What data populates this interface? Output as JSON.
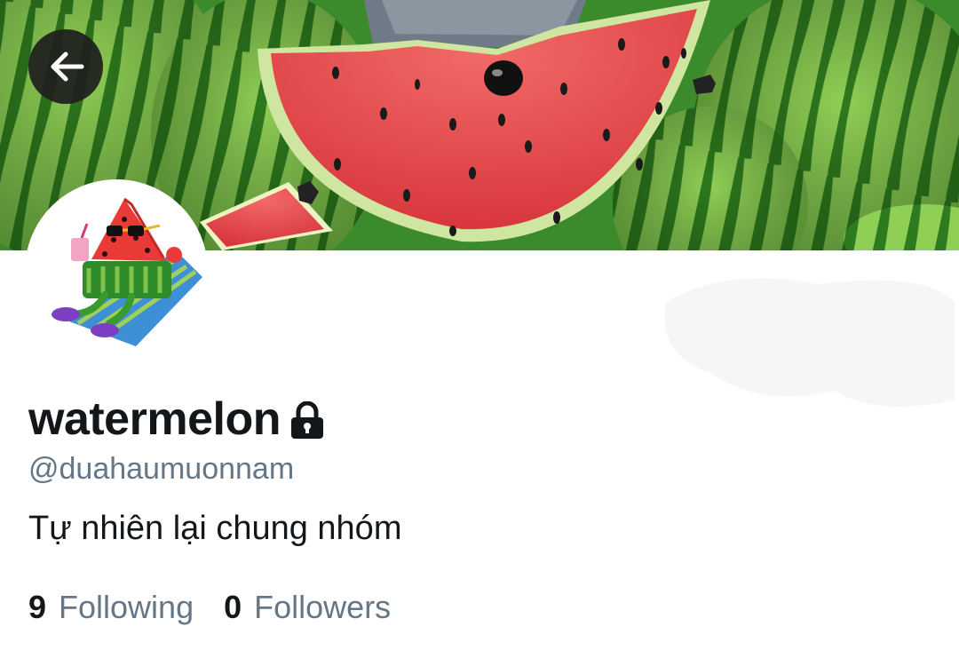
{
  "header": {
    "banner_image": "watermelon-mouse-banner",
    "back_icon": "arrow-left-icon"
  },
  "profile": {
    "avatar_image": "watermelon-sunglasses-avatar",
    "name": "watermelon",
    "lock_icon": "lock-icon",
    "handle": "@duahaumuonnam",
    "bio": "Tự nhiên lại chung nhóm"
  },
  "stats": {
    "following_count": "9",
    "following_label": "Following",
    "followers_count": "0",
    "followers_label": "Followers"
  },
  "colors": {
    "text_primary": "#14171a",
    "text_secondary": "#657786",
    "watermelon_red": "#e8454a",
    "rind_green": "#3f8f2a"
  }
}
